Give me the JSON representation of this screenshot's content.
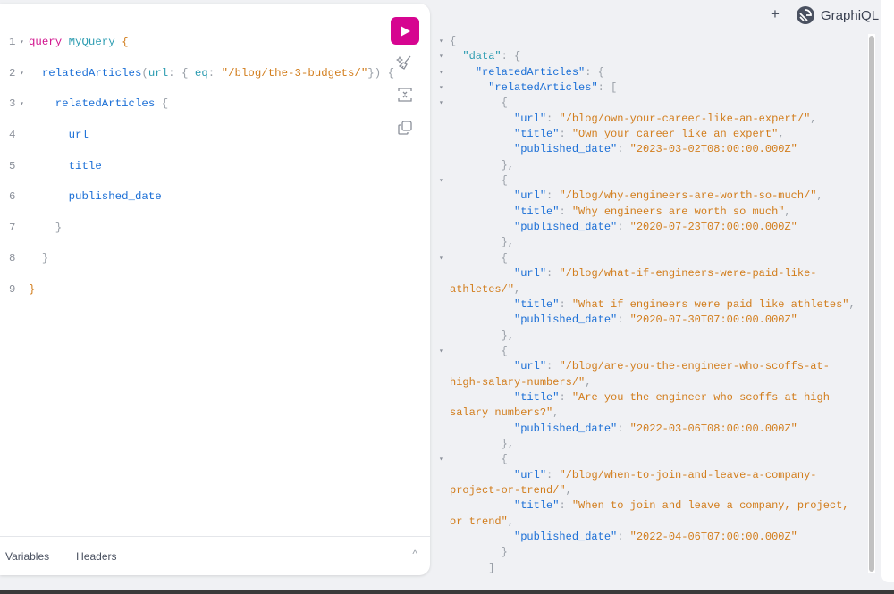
{
  "header": {
    "plus_label": "+",
    "logo_text": "GraphiQL"
  },
  "editor": {
    "lines": [
      {
        "n": "1",
        "fold": true
      },
      {
        "n": "2",
        "fold": true
      },
      {
        "n": "3",
        "fold": true
      },
      {
        "n": "4"
      },
      {
        "n": "5"
      },
      {
        "n": "6"
      },
      {
        "n": "7"
      },
      {
        "n": "8"
      },
      {
        "n": "9"
      }
    ],
    "query_kw": "query",
    "op_name": "MyQuery",
    "root_field": "relatedArticles",
    "arg_name": "url",
    "filter_op": "eq",
    "arg_value": "\"/blog/the-3-budgets/\"",
    "sub_field": "relatedArticles",
    "fields": [
      "url",
      "title",
      "published_date"
    ]
  },
  "footer": {
    "variables_tab": "Variables",
    "headers_tab": "Headers",
    "chevron": "^"
  },
  "results": {
    "data_key": "\"data\"",
    "outer_key": "\"relatedArticles\"",
    "inner_key": "\"relatedArticles\"",
    "url_key": "\"url\"",
    "title_key": "\"title\"",
    "date_key": "\"published_date\"",
    "articles": [
      {
        "url": "/blog/own-your-career-like-an-expert/",
        "title": "Own your career like an expert",
        "published_date": "2023-03-02T08:00:00.000Z"
      },
      {
        "url": "/blog/why-engineers-are-worth-so-much/",
        "title": "Why engineers are worth so much",
        "published_date": "2020-07-23T07:00:00.000Z"
      },
      {
        "url": "/blog/what-if-engineers-were-paid-like-athletes/",
        "title": "What if engineers were paid like athletes",
        "published_date": "2020-07-30T07:00:00.000Z"
      },
      {
        "url": "/blog/are-you-the-engineer-who-scoffs-at-high-salary-numbers/",
        "title": "Are you the engineer who scoffs at high salary numbers?",
        "published_date": "2022-03-06T08:00:00.000Z"
      },
      {
        "url": "/blog/when-to-join-and-leave-a-company-project-or-trend/",
        "title": "When to join and leave a company, project, or trend",
        "published_date": "2022-04-06T07:00:00.000Z"
      }
    ]
  },
  "colors": {
    "accent": "#d60590",
    "keyword": "#d1138d",
    "field": "#1b6fd6",
    "string": "#d27d1c"
  }
}
